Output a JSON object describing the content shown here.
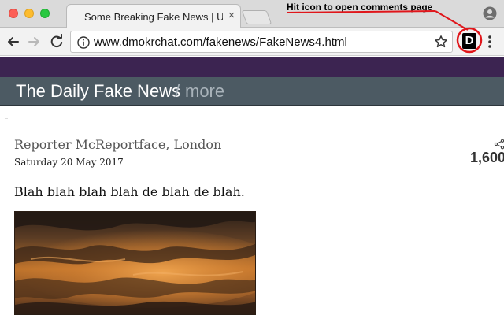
{
  "browser": {
    "tab": {
      "title": "Some Breaking Fake News | UK"
    },
    "annotation": "Hit icon to open comments page",
    "address_bar": {
      "url": "www.dmokrchat.com/fakenews/FakeNews4.html"
    },
    "extension": {
      "letter": "D",
      "icon": "extension-d-icon"
    }
  },
  "site": {
    "title": "The Daily Fake News",
    "separator": "/",
    "more": "more",
    "colors": {
      "topbar": "#3c2451",
      "header": "#4c5a63"
    }
  },
  "article": {
    "byline": "Reporter McReportface, London",
    "date": "Saturday 20 May 2017",
    "share_count": "1,600",
    "lead": "Blah blah blah blah de blah de blah."
  },
  "colors": {
    "annotation_red": "#e0161b"
  }
}
